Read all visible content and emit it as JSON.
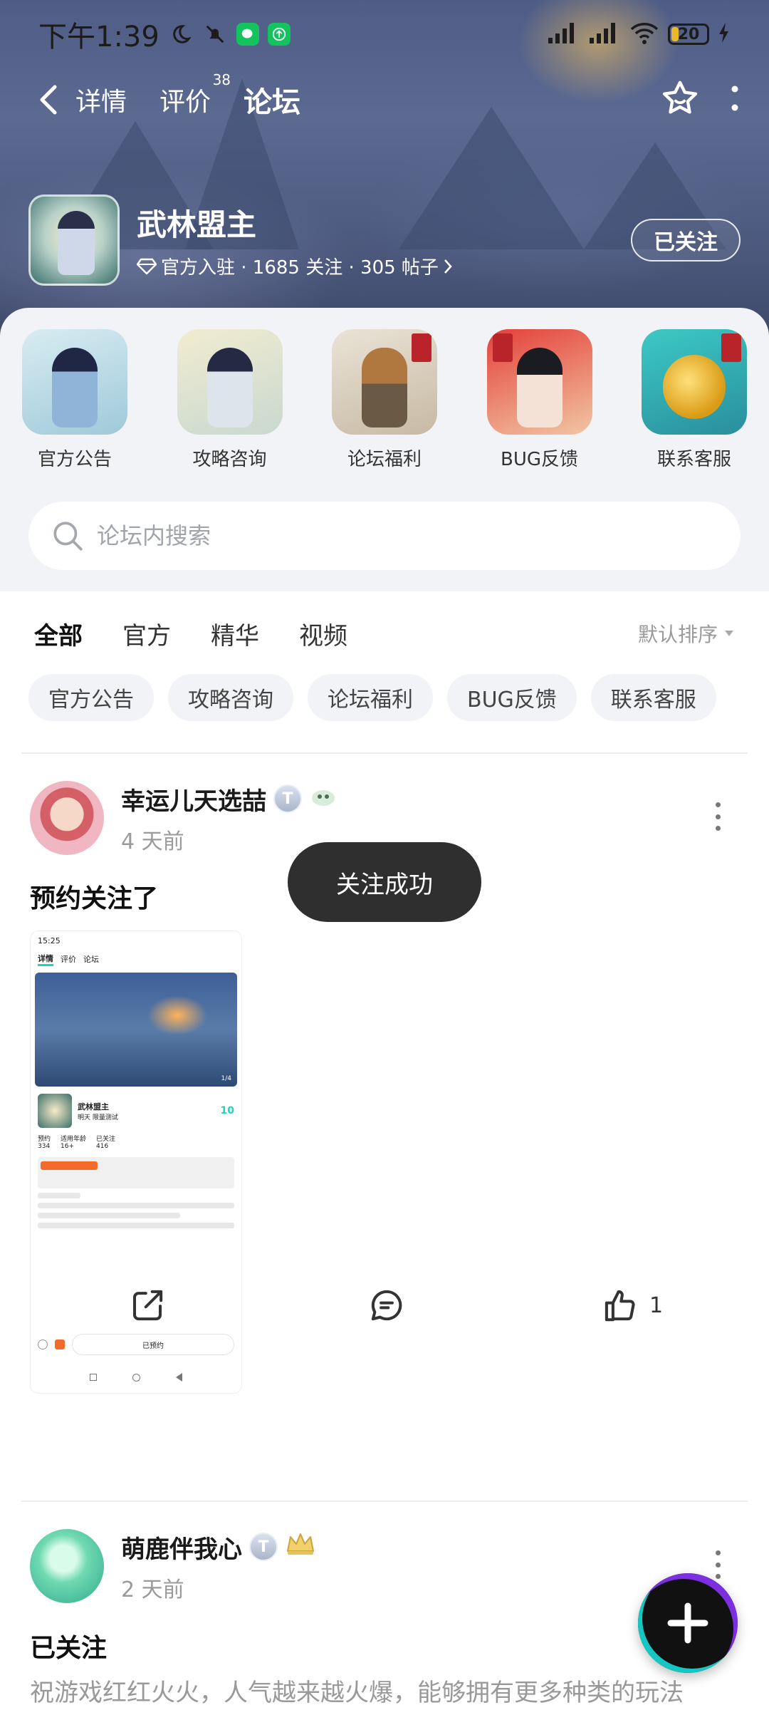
{
  "status_bar": {
    "time": "下午1:39",
    "battery": "20"
  },
  "nav": {
    "tabs": [
      {
        "label": "详情"
      },
      {
        "label": "评价",
        "count": "38"
      },
      {
        "label": "论坛"
      }
    ],
    "active_tab": "论坛"
  },
  "forum": {
    "name": "武林盟主",
    "meta": "官方入驻 · 1685 关注 · 305 帖子",
    "follow_label": "已关注"
  },
  "categories": [
    {
      "label": "官方公告"
    },
    {
      "label": "攻略咨询"
    },
    {
      "label": "论坛福利"
    },
    {
      "label": "BUG反馈"
    },
    {
      "label": "联系客服"
    }
  ],
  "search": {
    "placeholder": "论坛内搜索"
  },
  "feed_tabs": [
    {
      "label": "全部"
    },
    {
      "label": "官方"
    },
    {
      "label": "精华"
    },
    {
      "label": "视频"
    }
  ],
  "sort_label": "默认排序",
  "chips": [
    {
      "label": "官方公告"
    },
    {
      "label": "攻略咨询"
    },
    {
      "label": "论坛福利"
    },
    {
      "label": "BUG反馈"
    },
    {
      "label": "联系客服"
    }
  ],
  "posts": [
    {
      "username": "幸运儿天选喆",
      "time": "4 天前",
      "title": "预约关注了",
      "like_count": "1",
      "screenshot": {
        "time": "15:25",
        "tabs": [
          "详情",
          "评价",
          "论坛"
        ],
        "game_name": "武林盟主",
        "subtitle": "明天 限量测试",
        "stats": [
          "预约",
          "适用年龄",
          "已关注"
        ],
        "stat_values": [
          "334",
          "16+",
          "416"
        ],
        "reserve_label": "已预约",
        "page_indicator": "1/4",
        "badge_value": "10"
      }
    },
    {
      "username": "萌鹿伴我心",
      "time": "2 天前",
      "title": "已关注",
      "excerpt": "祝游戏红红火火，人气越来越火爆，能够拥有更多种类的玩法"
    }
  ],
  "toast": "关注成功",
  "colors": {
    "accent": "#1ed3bc",
    "toast_bg": "#2f2f2f",
    "fab_bg": "#111111"
  }
}
